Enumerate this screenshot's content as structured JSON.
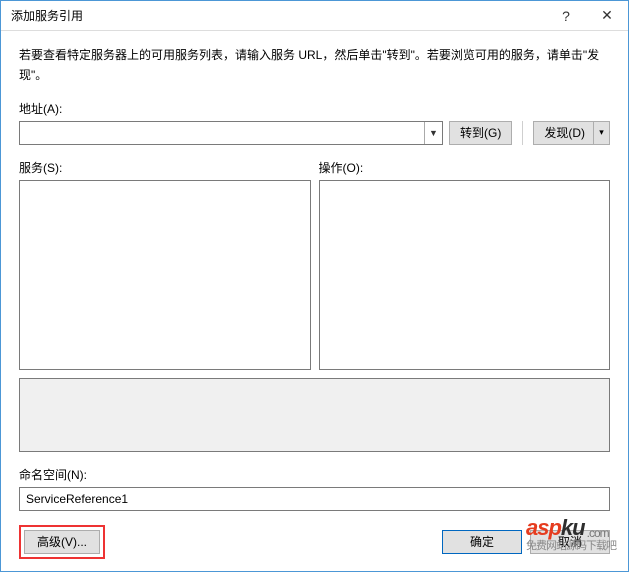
{
  "titlebar": {
    "title": "添加服务引用"
  },
  "instruction": "若要查看特定服务器上的可用服务列表，请输入服务 URL，然后单击\"转到\"。若要浏览可用的服务，请单击\"发现\"。",
  "labels": {
    "address": "地址(A):",
    "services": "服务(S):",
    "operations": "操作(O):",
    "namespace": "命名空间(N):"
  },
  "address": {
    "value": ""
  },
  "buttons": {
    "go": "转到(G)",
    "discover": "发现(D)",
    "advanced": "高级(V)...",
    "ok": "确定",
    "cancel": "取消"
  },
  "namespace": {
    "value": "ServiceReference1"
  },
  "watermark": {
    "top": "asp",
    "mid": "ku",
    "dot": ".com",
    "sub": "免费网站源码下载吧"
  }
}
